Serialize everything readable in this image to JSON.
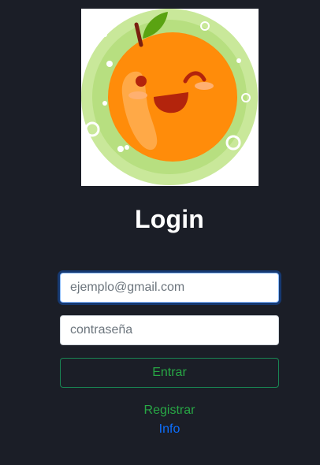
{
  "logo": {
    "icon": "orange-mascot-logo",
    "colors": {
      "ring": "#c9e89a",
      "orange": "#ff8c0a",
      "leaf": "#5aa312",
      "stem": "#7a1f10",
      "mouth": "#b3240c"
    }
  },
  "login": {
    "title": "Login",
    "email_placeholder": "ejemplo@gmail.com",
    "password_placeholder": "contraseña",
    "submit_label": "Entrar",
    "register_link": "Registrar",
    "info_link": "Info"
  },
  "colors": {
    "background": "#1b1e27",
    "success": "#28a745",
    "primary": "#0d6efd"
  }
}
